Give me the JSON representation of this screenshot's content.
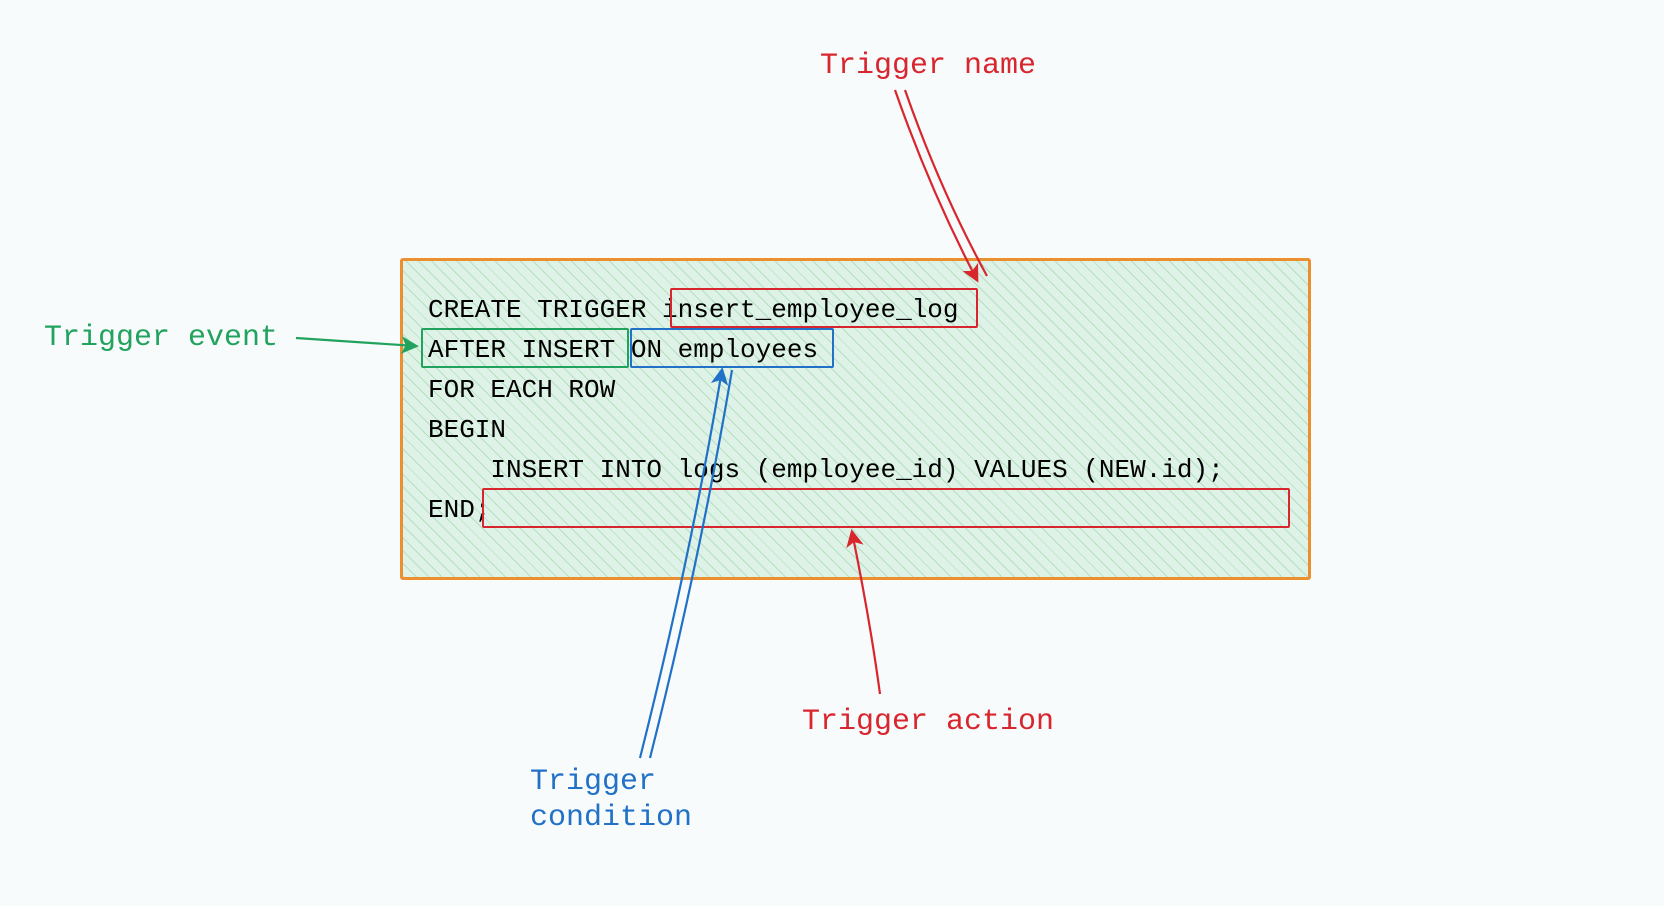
{
  "labels": {
    "trigger_name": "Trigger name",
    "trigger_event": "Trigger event",
    "trigger_condition": "Trigger\ncondition",
    "trigger_action": "Trigger action"
  },
  "code": {
    "line1_pre": "CREATE TRIGGER ",
    "line1_name": "insert_employee_log",
    "line2_event": "AFTER INSERT ",
    "line2_condition": "ON employees",
    "line3": "FOR EACH ROW",
    "line4": "BEGIN",
    "line5": "    INSERT INTO logs (employee_id) VALUES (NEW.id);",
    "line6": "END;"
  },
  "colors": {
    "red": "#d8262e",
    "green": "#21a35d",
    "blue": "#2171c7",
    "orange": "#ec8f2e"
  }
}
